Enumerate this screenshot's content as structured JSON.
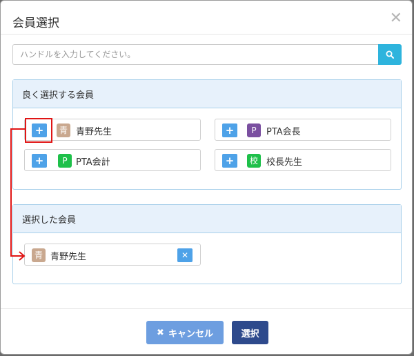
{
  "modal": {
    "title": "会員選択"
  },
  "search": {
    "placeholder": "ハンドルを入力してください。"
  },
  "frequent": {
    "heading": "良く選択する会員",
    "members": [
      {
        "badge": "青",
        "badge_color": "#c9a88f",
        "name": "青野先生"
      },
      {
        "badge": "P",
        "badge_color": "#7a4fa0",
        "name": "PTA会長"
      },
      {
        "badge": "P",
        "badge_color": "#1ec04a",
        "name": "PTA会計"
      },
      {
        "badge": "校",
        "badge_color": "#1ec04a",
        "name": "校長先生"
      }
    ]
  },
  "selected": {
    "heading": "選択した会員",
    "members": [
      {
        "badge": "青",
        "badge_color": "#c9a88f",
        "name": "青野先生"
      }
    ]
  },
  "footer": {
    "cancel_label": "キャンセル",
    "select_label": "選択"
  }
}
